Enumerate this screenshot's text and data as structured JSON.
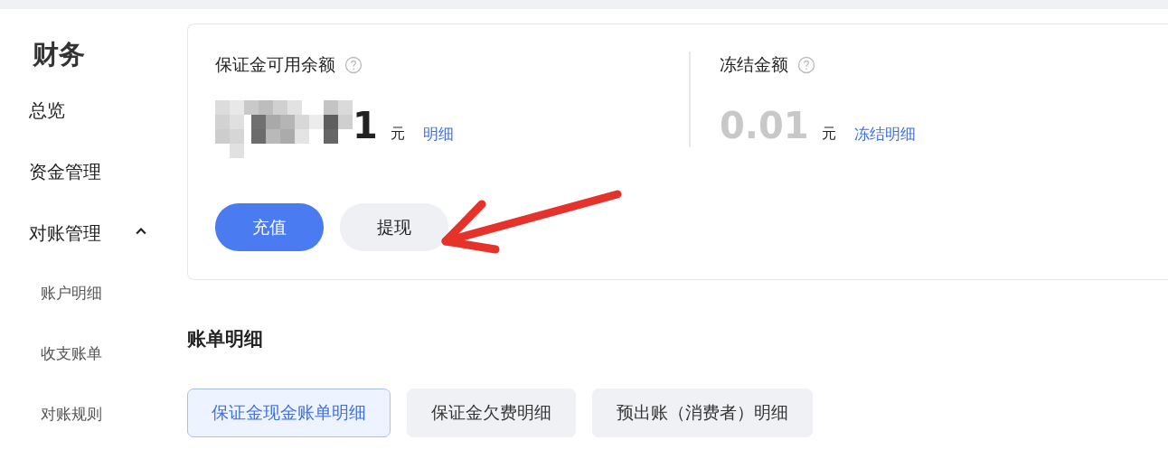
{
  "sidebar": {
    "title": "财务",
    "items": [
      {
        "label": "总览"
      },
      {
        "label": "资金管理"
      },
      {
        "label": "对账管理",
        "expanded": true,
        "children": [
          {
            "label": "账户明细"
          },
          {
            "label": "收支账单"
          },
          {
            "label": "对账规则"
          }
        ]
      }
    ]
  },
  "balances": [
    {
      "label": "保证金可用余额",
      "masked": true,
      "amount": "1",
      "unit": "元",
      "link": "明细",
      "dim": false
    },
    {
      "label": "冻结金额",
      "masked": false,
      "amount": "0.01",
      "unit": "元",
      "link": "冻结明细",
      "dim": true
    }
  ],
  "actions": [
    {
      "label": "充值",
      "kind": "primary"
    },
    {
      "label": "提现",
      "kind": "secondary"
    }
  ],
  "section_title": "账单明细",
  "tabs": [
    {
      "label": "保证金现金账单明细",
      "selected": true
    },
    {
      "label": "保证金欠费明细",
      "selected": false
    },
    {
      "label": "预出账（消费者）明细",
      "selected": false
    }
  ]
}
